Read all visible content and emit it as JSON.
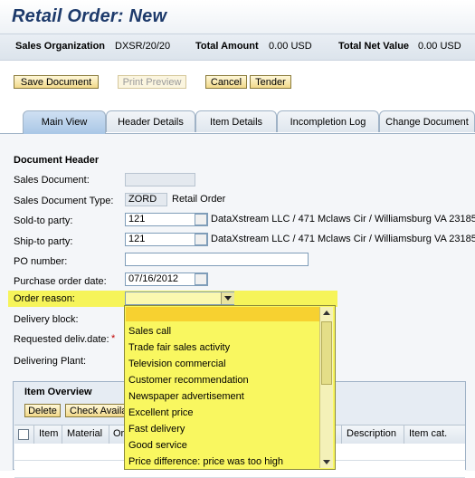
{
  "window": {
    "title": "Retail Order: New"
  },
  "info_bar": {
    "sales_org_label": "Sales Organization",
    "sales_org_value": "DXSR/20/20",
    "total_amount_label": "Total Amount",
    "total_amount_value": "0.00 USD",
    "total_net_label": "Total Net Value",
    "total_net_value": "0.00 USD"
  },
  "toolbar": {
    "save": "Save Document",
    "print_preview": "Print Preview",
    "cancel": "Cancel",
    "tender": "Tender"
  },
  "tabs": [
    "Main View",
    "Header Details",
    "Item Details",
    "Incompletion Log",
    "Change Document"
  ],
  "header_section": {
    "title": "Document Header",
    "fields": {
      "sales_document": {
        "label": "Sales Document:",
        "value": ""
      },
      "sales_doc_type": {
        "label": "Sales Document Type:",
        "code": "ZORD",
        "desc": "Retail Order"
      },
      "sold_to": {
        "label": "Sold-to party:",
        "value": "121",
        "desc": "DataXstream LLC / 471 Mclaws Cir / Williamsburg VA 23185"
      },
      "ship_to": {
        "label": "Ship-to party:",
        "value": "121",
        "desc": "DataXstream LLC / 471 Mclaws Cir / Williamsburg VA 23185"
      },
      "po_number": {
        "label": "PO number:",
        "value": ""
      },
      "po_date": {
        "label": "Purchase order date:",
        "value": "07/16/2012"
      },
      "order_reason": {
        "label": "Order reason:",
        "value": ""
      },
      "delivery_block": {
        "label": "Delivery block:"
      },
      "req_deliv_date": {
        "label": "Requested deliv.date:",
        "required_marker": "*"
      },
      "delivering_plant": {
        "label": "Delivering Plant:"
      }
    }
  },
  "order_reason_options": [
    "Sales call",
    "Trade fair sales activity",
    "Television commercial",
    "Customer recommendation",
    "Newspaper advertisement",
    "Excellent price",
    "Fast delivery",
    "Good service",
    "Price difference: price was too high"
  ],
  "item_overview": {
    "title": "Item Overview",
    "buttons": {
      "delete": "Delete",
      "check_availability": "Check Availa"
    },
    "columns": [
      "Item",
      "Material",
      "Or",
      "Description",
      "Item cat."
    ]
  },
  "colors": {
    "title": "#1d3a6b",
    "highlight": "#f6f45a",
    "dropdown_selected": "#f7d130"
  }
}
